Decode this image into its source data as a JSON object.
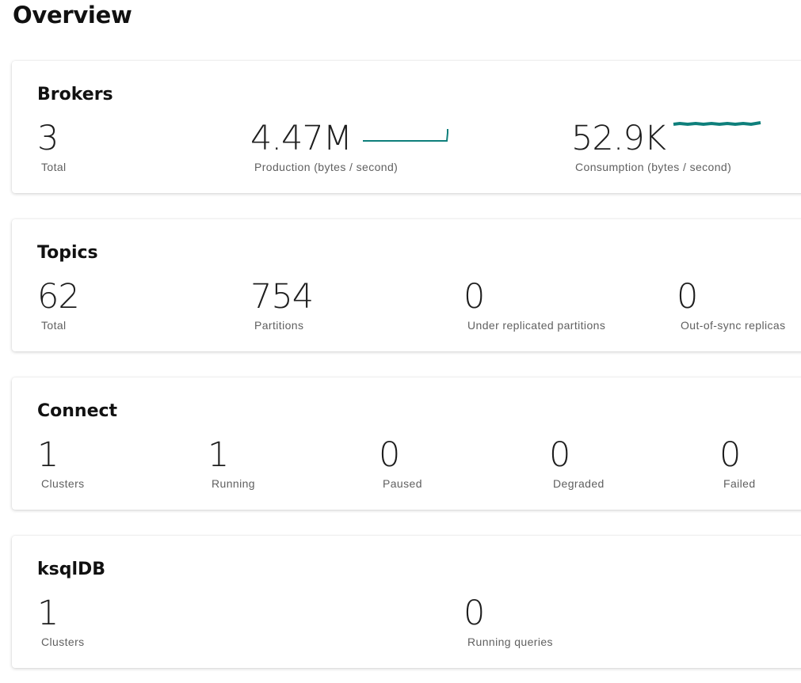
{
  "page": {
    "title": "Overview"
  },
  "brokers": {
    "title": "Brokers",
    "total_value": "3",
    "total_label": "Total",
    "production_value": "4.47M",
    "production_label": "Production (bytes / second)",
    "consumption_value": "52.9K",
    "consumption_label": "Consumption (bytes / second)"
  },
  "topics": {
    "title": "Topics",
    "total_value": "62",
    "total_label": "Total",
    "partitions_value": "754",
    "partitions_label": "Partitions",
    "under_replicated_value": "0",
    "under_replicated_label": "Under replicated partitions",
    "out_of_sync_value": "0",
    "out_of_sync_label": "Out-of-sync replicas"
  },
  "connect": {
    "title": "Connect",
    "clusters_value": "1",
    "clusters_label": "Clusters",
    "running_value": "1",
    "running_label": "Running",
    "paused_value": "0",
    "paused_label": "Paused",
    "degraded_value": "0",
    "degraded_label": "Degraded",
    "failed_value": "0",
    "failed_label": "Failed"
  },
  "ksqldb": {
    "title": "ksqlDB",
    "clusters_value": "1",
    "clusters_label": "Clusters",
    "running_queries_value": "0",
    "running_queries_label": "Running queries"
  },
  "colors": {
    "sparkline": "#0e7f7b"
  },
  "icons": {
    "production_chart": "production-sparkline-icon",
    "consumption_chart": "consumption-sparkline-icon"
  }
}
